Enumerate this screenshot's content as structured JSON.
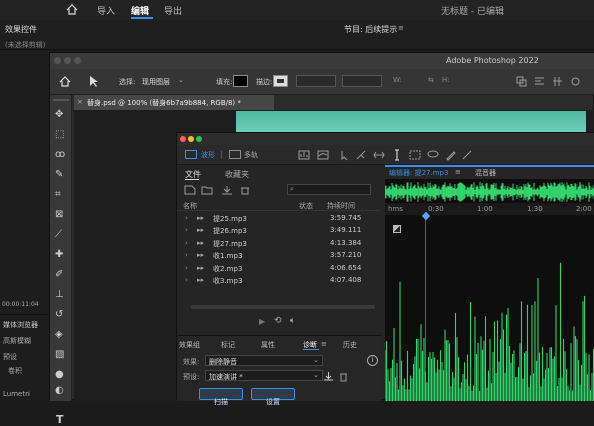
{
  "premiere": {
    "tabs": [
      "导入",
      "编辑",
      "导出"
    ],
    "active_tab": "编辑",
    "doc_title": "无标题 - 已编辑",
    "left_panel_title": "效果控件",
    "left_panel_placeholder": "(未选择剪辑)",
    "program_panel_title": "节目: 后续提示",
    "timecode": "00:00:11:04",
    "media_browser": "媒体浏览器",
    "media_items": [
      "高斯模糊",
      "预设",
      "卷积",
      "Lumetri"
    ]
  },
  "photoshop": {
    "app_title": "Adobe Photoshop 2022",
    "options": {
      "select_label": "选择:",
      "select_value": "现用图层",
      "fill_label": "填充:",
      "stroke_label": "描边:"
    },
    "doc_tab": "替身.psd @ 100% (替身6b7a9b884, RGB/8) *"
  },
  "audition": {
    "view_tabs": [
      "波形",
      "多轨"
    ],
    "active_view": "波形",
    "panel_tabs": [
      "文件",
      "收藏夹"
    ],
    "columns": {
      "name": "名称",
      "status": "状态",
      "duration": "持续时间"
    },
    "files": [
      {
        "name": "提25.mp3",
        "duration": "3:59.745",
        "selected": false
      },
      {
        "name": "提26.mp3",
        "duration": "3:49.111",
        "selected": false
      },
      {
        "name": "提27.mp3",
        "duration": "4:13.384",
        "selected": true
      },
      {
        "name": "收1.mp3",
        "duration": "3:57.210",
        "selected": false
      },
      {
        "name": "收2.mp3",
        "duration": "4:06.654",
        "selected": false
      },
      {
        "name": "收3.mp3",
        "duration": "4:07.408",
        "selected": false
      }
    ],
    "effect_tabs": [
      "效果组",
      "标记",
      "属性",
      "诊断",
      "历史"
    ],
    "active_effect_tab": "诊断",
    "effect_label": "效果:",
    "effect_value": "删除静音",
    "preset_label": "预设:",
    "preset_value": "加速演讲 *",
    "scan_button": "扫描",
    "settings_button": "设置",
    "editor_title": "编辑器: 提27.mp3",
    "mixer_tab": "混音器",
    "ruler": [
      "hms",
      "0:30",
      "1:00",
      "1:30",
      "2:00"
    ]
  },
  "colors": {
    "accent": "#3b8ee5",
    "waveform": "#2fd46a",
    "selected_file": "#6fa8ff"
  }
}
